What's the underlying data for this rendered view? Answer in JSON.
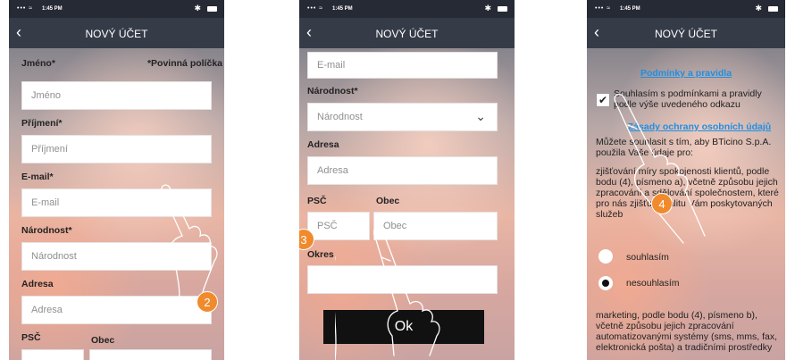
{
  "status": {
    "time": "1:45 PM",
    "signal": "••• ≈",
    "bt": "✱"
  },
  "nav": {
    "back": "‹",
    "title": "NOVÝ ÚČET"
  },
  "p1": {
    "name_label": "Jméno*",
    "required_note": "*Povinná políčka",
    "name_ph": "Jméno",
    "surname_label": "Příjmení*",
    "surname_ph": "Příjmení",
    "email_label": "E-mail*",
    "email_ph": "E-mail",
    "nationality_label": "Národnost*",
    "nationality_ph": "Národnost",
    "address_label": "Adresa",
    "address_ph": "Adresa",
    "psc_label": "PSČ",
    "obec_label": "Obec",
    "step": "2"
  },
  "p2": {
    "email_ph": "E-mail",
    "nationality_label": "Národnost*",
    "nationality_value": "Národnost",
    "chevron": "⌄",
    "address_label": "Adresa",
    "address_ph": "Adresa",
    "psc_label": "PSČ",
    "obec_label": "Obec",
    "psc_ph": "PSČ",
    "obec_ph": "Obec",
    "okres_label": "Okres",
    "ok_label": "Ok",
    "step": "3"
  },
  "p3": {
    "terms_link": "Podmínky a pravidla",
    "check_mark": "✔",
    "consent_text": "Souhlasím s podmínkami a pravidly podle výše uvedeného odkazu",
    "privacy_link": "Zásady ochrany osobních údajů",
    "para1": "Můžete souhlasit s tím, aby BTicino S.p.A. použila Vaše údaje pro:",
    "para2": "zjišťování míry spokojenosti klientů, podle bodu (4), písmeno a), včetně způsobu jejich zpracování a sdělování společnostem, které pro nás zjišťují kvalitu Vám poskytovaných služeb",
    "agree": "souhlasím",
    "disagree": "nesouhlasím",
    "footer": "marketing, podle bodu (4), písmeno b), včetně způsobu jejich zpracování automatizovanými systémy (sms, mms, fax, elektronická pošta) a tradičními prostředky",
    "step": "4"
  }
}
